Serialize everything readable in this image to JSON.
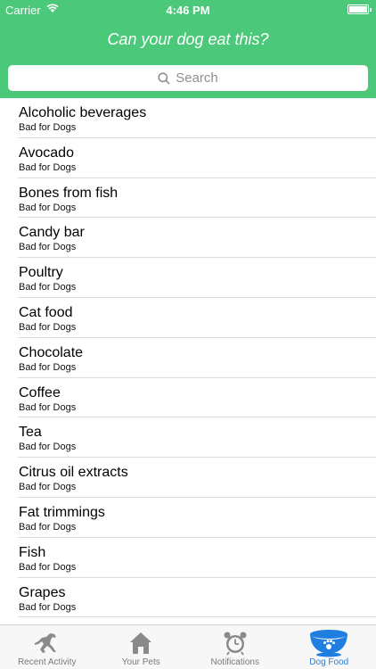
{
  "status_bar": {
    "carrier": "Carrier",
    "time": "4:46 PM"
  },
  "header": {
    "title": "Can your dog eat this?"
  },
  "search": {
    "placeholder": "Search"
  },
  "items": [
    {
      "name": "Alcoholic beverages",
      "status": "Bad for Dogs"
    },
    {
      "name": "Avocado",
      "status": "Bad for Dogs"
    },
    {
      "name": "Bones from fish",
      "status": "Bad for Dogs"
    },
    {
      "name": "Candy bar",
      "status": "Bad for Dogs"
    },
    {
      "name": "Poultry",
      "status": "Bad for Dogs"
    },
    {
      "name": "Cat food",
      "status": "Bad for Dogs"
    },
    {
      "name": "Chocolate",
      "status": "Bad for Dogs"
    },
    {
      "name": "Coffee",
      "status": "Bad for Dogs"
    },
    {
      "name": "Tea",
      "status": "Bad for Dogs"
    },
    {
      "name": "Citrus oil extracts",
      "status": "Bad for Dogs"
    },
    {
      "name": "Fat trimmings",
      "status": "Bad for Dogs"
    },
    {
      "name": "Fish",
      "status": "Bad for Dogs"
    },
    {
      "name": "Grapes",
      "status": "Bad for Dogs"
    }
  ],
  "tabs": [
    {
      "label": "Recent Activity",
      "icon": "running-dog-icon"
    },
    {
      "label": "Your Pets",
      "icon": "house-icon"
    },
    {
      "label": "Notifications",
      "icon": "alarm-clock-icon"
    },
    {
      "label": "Dog Food",
      "icon": "dog-bowl-icon"
    }
  ],
  "colors": {
    "header": "#4cc87a",
    "active_tab": "#2a7fd6",
    "inactive_tab": "#7a7a7a"
  }
}
